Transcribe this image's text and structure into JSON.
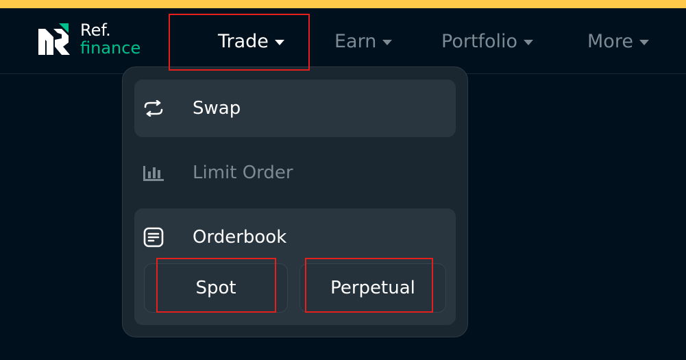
{
  "logo": {
    "line1": "Ref.",
    "line2": "finance",
    "icon": "ref-finance-logo-icon"
  },
  "nav": {
    "trade": "Trade",
    "earn": "Earn",
    "portfolio": "Portfolio",
    "more": "More"
  },
  "dropdown": {
    "swap": {
      "label": "Swap",
      "icon": "swap-arrows-icon"
    },
    "limit_order": {
      "label": "Limit Order",
      "icon": "candlestick-icon"
    },
    "orderbook": {
      "label": "Orderbook",
      "icon": "document-lines-icon",
      "spot": "Spot",
      "perpetual": "Perpetual"
    }
  },
  "colors": {
    "background": "#00101d",
    "accent_green": "#00c08b",
    "top_strip": "#ffc84a",
    "highlight_red": "#e3201b",
    "menu_bg": "#1a2630",
    "item_bg": "#2a363f"
  }
}
